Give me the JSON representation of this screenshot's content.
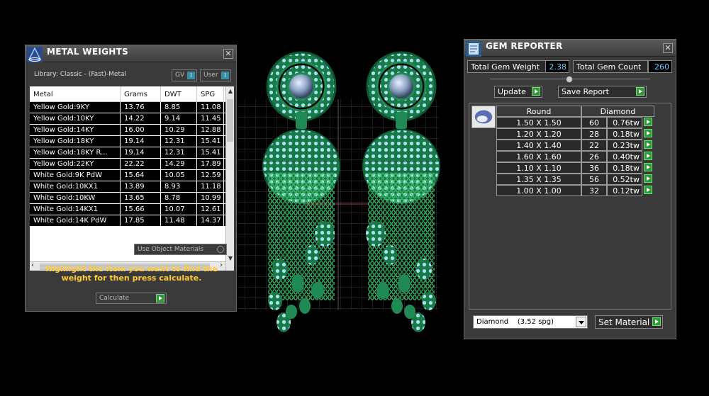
{
  "metal_weights": {
    "title": "METAL WEIGHTS",
    "library": "Library: Classic - (Fast)-Metal",
    "gv_label": "GV",
    "user_label": "User",
    "toggle_glyph": "I",
    "columns": [
      "Metal",
      "Grams",
      "DWT",
      "SPG"
    ],
    "rows": [
      [
        "Yellow Gold:9KY",
        "13.76",
        "8.85",
        "11.08"
      ],
      [
        "Yellow Gold:10KY",
        "14.22",
        "9.14",
        "11.45"
      ],
      [
        "Yellow Gold:14KY",
        "16.00",
        "10.29",
        "12.88"
      ],
      [
        "Yellow Gold:18KY",
        "19.14",
        "12.31",
        "15.41"
      ],
      [
        "Yellow Gold:18KY R...",
        "19.14",
        "12.31",
        "15.41"
      ],
      [
        "Yellow Gold:22KY",
        "22.22",
        "14.29",
        "17.89"
      ],
      [
        "White Gold:9K PdW",
        "15.64",
        "10.05",
        "12.59"
      ],
      [
        "White Gold:10KX1",
        "13.89",
        "8.93",
        "11.18"
      ],
      [
        "White Gold:10KW",
        "13.65",
        "8.78",
        "10.99"
      ],
      [
        "White Gold:14KX1",
        "15.66",
        "10.07",
        "12.61"
      ],
      [
        "White Gold:14K PdW",
        "17.85",
        "11.48",
        "14.37"
      ]
    ],
    "use_object_materials": "Use Object Materials",
    "hint": "Highlight the item you want to find the weight for then press calculate.",
    "calculate_label": "Calculate"
  },
  "gem_reporter": {
    "title": "GEM REPORTER",
    "total_weight_label": "Total Gem Weight",
    "total_weight_value": "2.38",
    "total_count_label": "Total Gem Count",
    "total_count_value": "260",
    "update_label": "Update",
    "save_report_label": "Save Report",
    "shape_header": "Round",
    "material_header": "Diamond",
    "gems": [
      [
        "1.50 X 1.50",
        "60",
        "0.76tw"
      ],
      [
        "1.20 X 1.20",
        "28",
        "0.18tw"
      ],
      [
        "1.40 X 1.40",
        "22",
        "0.23tw"
      ],
      [
        "1.60 X 1.60",
        "26",
        "0.40tw"
      ],
      [
        "1.10 X 1.10",
        "36",
        "0.18tw"
      ],
      [
        "1.35 X 1.35",
        "56",
        "0.52tw"
      ],
      [
        "1.00 X 1.00",
        "32",
        "0.12tw"
      ]
    ],
    "material_select": "Diamond    (3.52 spg)",
    "set_material_label": "Set Material"
  },
  "colors": {
    "jewel_green": "#1f8a55",
    "gem_blue": "#9fd8e8",
    "hint_yellow": "#ffcc33",
    "value_blue": "#6cc8ff",
    "button_green": "#2e9a3a"
  },
  "icons": [
    "metal-weights-icon",
    "gem-reporter-icon",
    "close-icon",
    "go-arrow-icon",
    "dropdown-arrow-icon",
    "gem-shape-icon"
  ]
}
